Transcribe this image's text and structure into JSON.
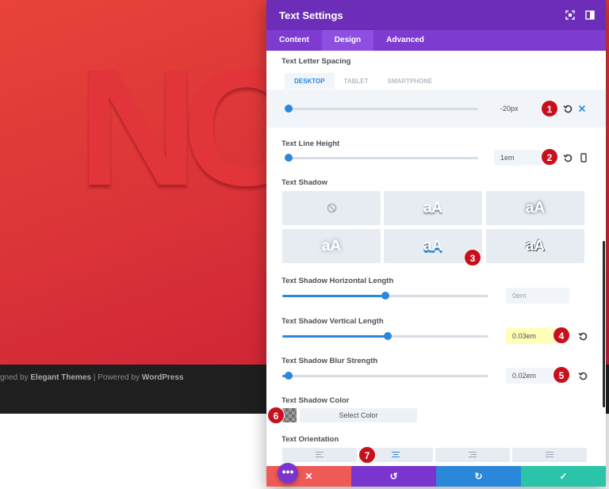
{
  "background": {
    "hero_text": "NO",
    "footer": {
      "prefix": "gned by ",
      "brand": "Elegant Themes",
      "sep": " | Powered by ",
      "platform": "WordPress"
    }
  },
  "modal": {
    "title": "Text Settings",
    "header_icons": [
      "fullscreen-icon",
      "sidebar-toggle-icon"
    ],
    "tabs": [
      "Content",
      "Design",
      "Advanced"
    ],
    "active_tab": "Design"
  },
  "letter_spacing": {
    "label": "Text Letter Spacing",
    "device_tabs": [
      "DESKTOP",
      "TABLET",
      "SMARTPHONE"
    ],
    "value": "-20px",
    "slider_fraction": 0.0
  },
  "line_height": {
    "label": "Text Line Height",
    "value": "1em",
    "slider_fraction": 0.0
  },
  "text_shadow": {
    "label": "Text Shadow",
    "presets": [
      "none",
      "aA",
      "aA",
      "aA",
      "aA",
      "aA"
    ],
    "horizontal": {
      "label": "Text Shadow Horizontal Length",
      "value": "0em",
      "slider_fraction": 0.5
    },
    "vertical": {
      "label": "Text Shadow Vertical Length",
      "value": "0.03em",
      "slider_fraction": 0.51
    },
    "blur": {
      "label": "Text Shadow Blur Strength",
      "value": "0.02em",
      "slider_fraction": 0.03
    },
    "color": {
      "label": "Text Shadow Color",
      "button": "Select Color"
    }
  },
  "orientation": {
    "label": "Text Orientation",
    "options": [
      "left",
      "center",
      "right",
      "justify"
    ],
    "active": "center"
  },
  "badges": [
    "1",
    "2",
    "3",
    "4",
    "5",
    "6",
    "7"
  ],
  "actions": {
    "fab": "•••",
    "cancel": "✕",
    "undo": "↺",
    "redo": "↻",
    "save": "✓"
  },
  "colors": {
    "header": "#6c2eb9",
    "tabs": "#7e3bd0",
    "accent": "#2b87da",
    "badge": "#c8101c",
    "cancel": "#ef5a57",
    "undo": "#7b35cf",
    "redo": "#2b87da",
    "save": "#29c4a9"
  }
}
